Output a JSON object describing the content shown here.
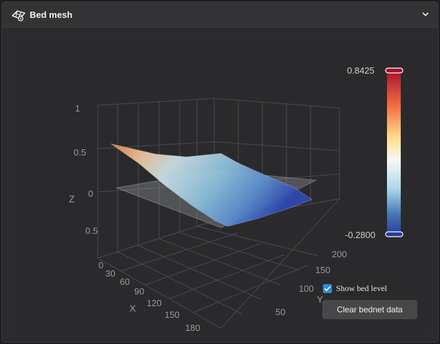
{
  "header": {
    "title": "Bed mesh"
  },
  "legend": {
    "max": "0.8425",
    "min": "-0.2800"
  },
  "axes": {
    "z_label": "Z",
    "x_label": "X",
    "y_label": "Y",
    "z_ticks": [
      "1",
      "0.5",
      "0",
      "0.5",
      "0"
    ],
    "x_ticks": [
      "30",
      "60",
      "90",
      "120",
      "150",
      "180"
    ],
    "y_ticks": [
      "200",
      "150",
      "100",
      "50"
    ]
  },
  "controls": {
    "show_bed_level_label": "Show bed level",
    "show_bed_level_checked": true,
    "clear_button_label": "Clear bednet data"
  },
  "chart_data": {
    "type": "surface",
    "title": "",
    "xlabel": "X",
    "ylabel": "Y",
    "zlabel": "Z",
    "color_scale": {
      "min": -0.28,
      "max": 0.8425
    },
    "x_ticks": [
      30,
      60,
      90,
      120,
      150,
      180
    ],
    "y_ticks": [
      50,
      100,
      150,
      200
    ],
    "z_ticks": [
      0,
      0.5,
      1
    ],
    "bed_level_plane": true
  },
  "colors": {
    "accent_checkbox": "#2d8ed6",
    "gradient_top": "#b2182b",
    "gradient_mid": "#ffffbf",
    "gradient_bottom": "#2c3da0"
  }
}
